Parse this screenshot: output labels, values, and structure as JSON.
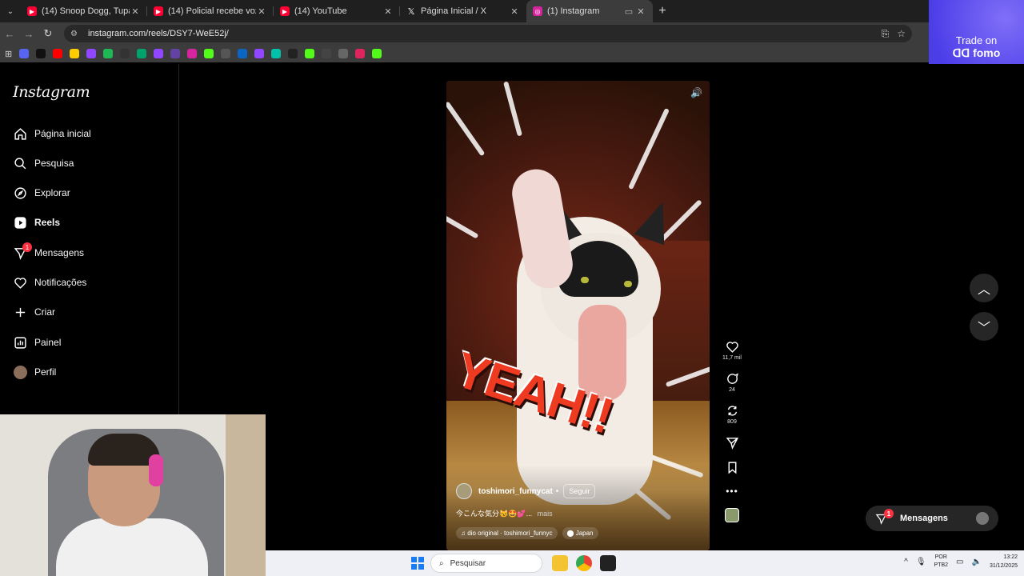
{
  "browser": {
    "tabs": [
      {
        "title": "(14) Snoop Dogg, Tupac, Nate",
        "favicon_color": "#ff0033",
        "active": false
      },
      {
        "title": "(14) Policial recebe voz de prisã",
        "favicon_color": "#ff0033",
        "active": false
      },
      {
        "title": "(14) YouTube",
        "favicon_color": "#ff0033",
        "active": false
      },
      {
        "title": "Página Inicial / X",
        "favicon_color": "#000000",
        "active": false
      },
      {
        "title": "(1) Instagram",
        "favicon_color": "#d6249f",
        "active": true
      }
    ],
    "url": "instagram.com/reels/DSY7-WeE52j/",
    "bookmark_colors": [
      "#5865f2",
      "#111111",
      "#ff0000",
      "#ffcc00",
      "#9146ff",
      "#1db954",
      "#333333",
      "#00a36c",
      "#9146ff",
      "#6441a5",
      "#d6249f",
      "#53fc18",
      "#555555",
      "#0a66c2",
      "#9146ff",
      "#00c2a8",
      "#222222",
      "#53fc18",
      "#444444",
      "#666666",
      "#e0245e",
      "#53fc18"
    ]
  },
  "ad": {
    "line1": "Trade on",
    "line2": "fomo"
  },
  "instagram": {
    "logo": "Instagram",
    "nav": [
      {
        "label": "Página inicial",
        "icon": "home-icon",
        "bold": false
      },
      {
        "label": "Pesquisa",
        "icon": "search-icon",
        "bold": false
      },
      {
        "label": "Explorar",
        "icon": "compass-icon",
        "bold": false
      },
      {
        "label": "Reels",
        "icon": "reels-icon",
        "bold": true
      },
      {
        "label": "Mensagens",
        "icon": "messenger-icon",
        "bold": false,
        "badge": "1"
      },
      {
        "label": "Notificações",
        "icon": "heart-icon",
        "bold": false
      },
      {
        "label": "Criar",
        "icon": "plus-icon",
        "bold": false
      },
      {
        "label": "Painel",
        "icon": "dashboard-icon",
        "bold": false
      },
      {
        "label": "Perfil",
        "icon": "profile-avatar",
        "bold": false
      }
    ],
    "reel": {
      "overlay_text": "YEAH!!",
      "username": "toshimori_funnycat",
      "follow": "Seguir",
      "caption": "今こんな気分😼🤩💕...",
      "more": "mais",
      "audio": "dio original · toshimori_funnyc",
      "location": "Japan"
    },
    "actions": {
      "likes": "11,7 mil",
      "comments": "24",
      "reposts": "809"
    },
    "messages_button": {
      "label": "Mensagens",
      "badge": "1"
    }
  },
  "taskbar": {
    "search_placeholder": "Pesquisar",
    "lang_line1": "POR",
    "lang_line2": "PTB2",
    "time": "13:22",
    "date": "31/12/2025"
  }
}
